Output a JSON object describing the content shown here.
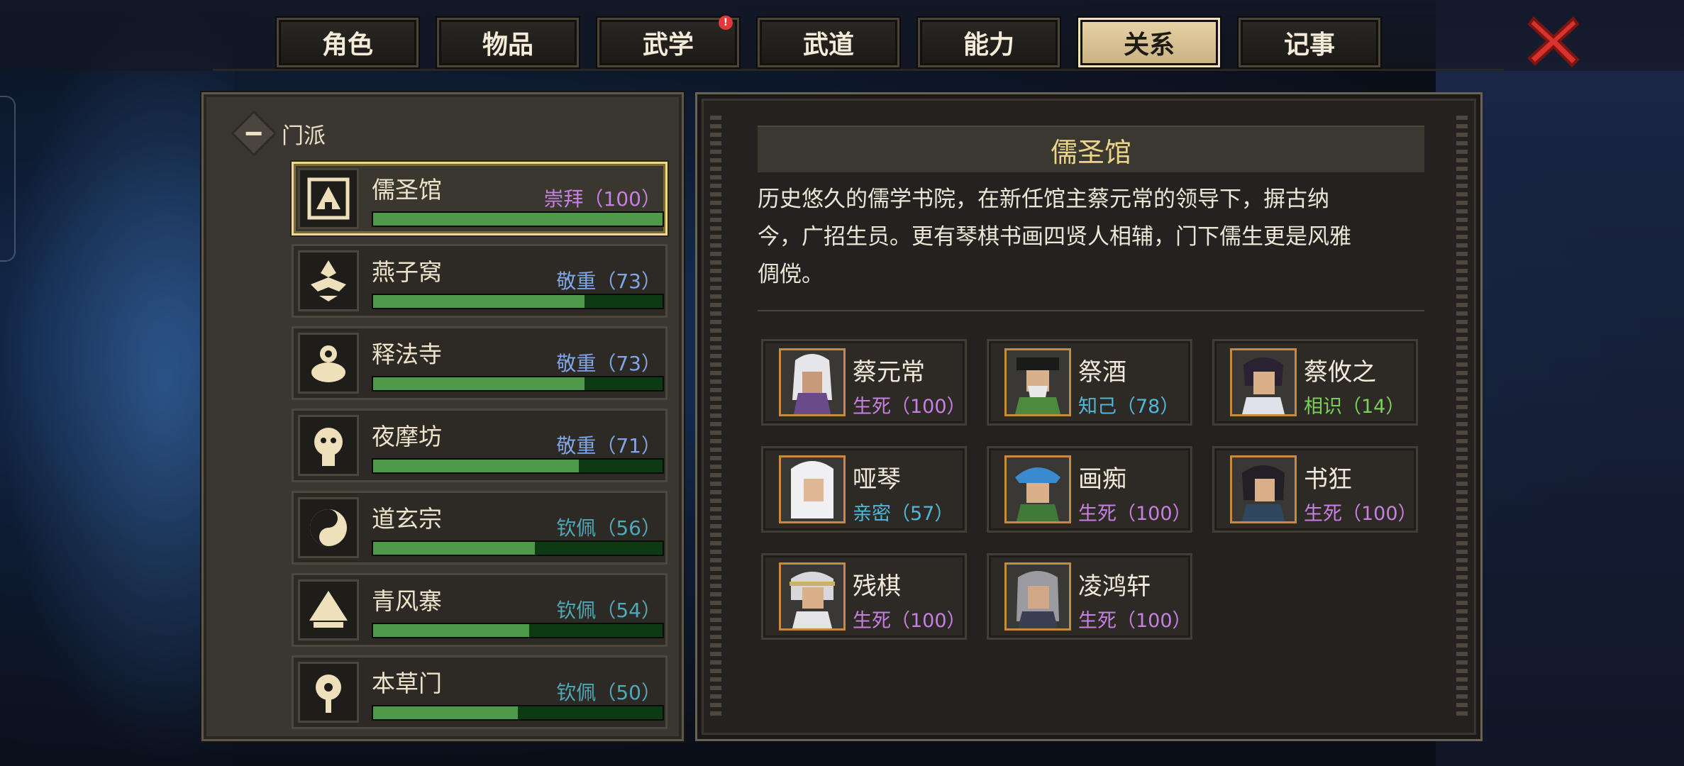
{
  "tabs": [
    {
      "label": "角色",
      "active": false,
      "badge": ""
    },
    {
      "label": "物品",
      "active": false,
      "badge": ""
    },
    {
      "label": "武学",
      "active": false,
      "badge": "!"
    },
    {
      "label": "武道",
      "active": false,
      "badge": ""
    },
    {
      "label": "能力",
      "active": false,
      "badge": ""
    },
    {
      "label": "关系",
      "active": true,
      "badge": ""
    },
    {
      "label": "记事",
      "active": false,
      "badge": ""
    }
  ],
  "close_icon": "close-x-icon",
  "group": {
    "label": "门派",
    "toggle_icon": "collapse-minus-icon"
  },
  "factions": [
    {
      "name": "儒圣馆",
      "status": "崇拜（100）",
      "status_color": "#c77fe0",
      "progress": 1.0,
      "selected": true
    },
    {
      "name": "燕子窝",
      "status": "敬重（73）",
      "status_color": "#7fa6e8",
      "progress": 0.73,
      "selected": false
    },
    {
      "name": "释法寺",
      "status": "敬重（73）",
      "status_color": "#7fa6e8",
      "progress": 0.73,
      "selected": false
    },
    {
      "name": "夜摩坊",
      "status": "敬重（71）",
      "status_color": "#7fa6e8",
      "progress": 0.71,
      "selected": false
    },
    {
      "name": "道玄宗",
      "status": "钦佩（56）",
      "status_color": "#4fa9b8",
      "progress": 0.56,
      "selected": false
    },
    {
      "name": "青风寨",
      "status": "钦佩（54）",
      "status_color": "#4fa9b8",
      "progress": 0.54,
      "selected": false
    },
    {
      "name": "本草门",
      "status": "钦佩（50）",
      "status_color": "#4fa9b8",
      "progress": 0.5,
      "selected": false
    }
  ],
  "detail": {
    "title": "儒圣馆",
    "description_lines": [
      "历史悠久的儒学书院，在新任馆主蔡元常的领导下，摒古纳",
      "今，广招生员。更有琴棋书画四贤人相辅，门下儒生更是风雅",
      "倜傥。"
    ],
    "members": [
      {
        "name": "蔡元常",
        "relation": "生死（100）",
        "color": "#c77fe0"
      },
      {
        "name": "祭酒",
        "relation": "知己（78）",
        "color": "#4fb8d8"
      },
      {
        "name": "蔡攸之",
        "relation": "相识（14）",
        "color": "#7ccf5a"
      },
      {
        "name": "哑琴",
        "relation": "亲密（57）",
        "color": "#4fb8d8"
      },
      {
        "name": "画痴",
        "relation": "生死（100）",
        "color": "#c77fe0"
      },
      {
        "name": "书狂",
        "relation": "生死（100）",
        "color": "#c77fe0"
      },
      {
        "name": "残棋",
        "relation": "生死（100）",
        "color": "#c77fe0"
      },
      {
        "name": "凌鸿轩",
        "relation": "生死（100）",
        "color": "#c77fe0"
      }
    ]
  },
  "colors": {
    "accent_gold": "#ecd58a",
    "bar_fill": "#4c9a4a",
    "bar_track": "#0d3a12",
    "close_red": "#d8322d"
  }
}
